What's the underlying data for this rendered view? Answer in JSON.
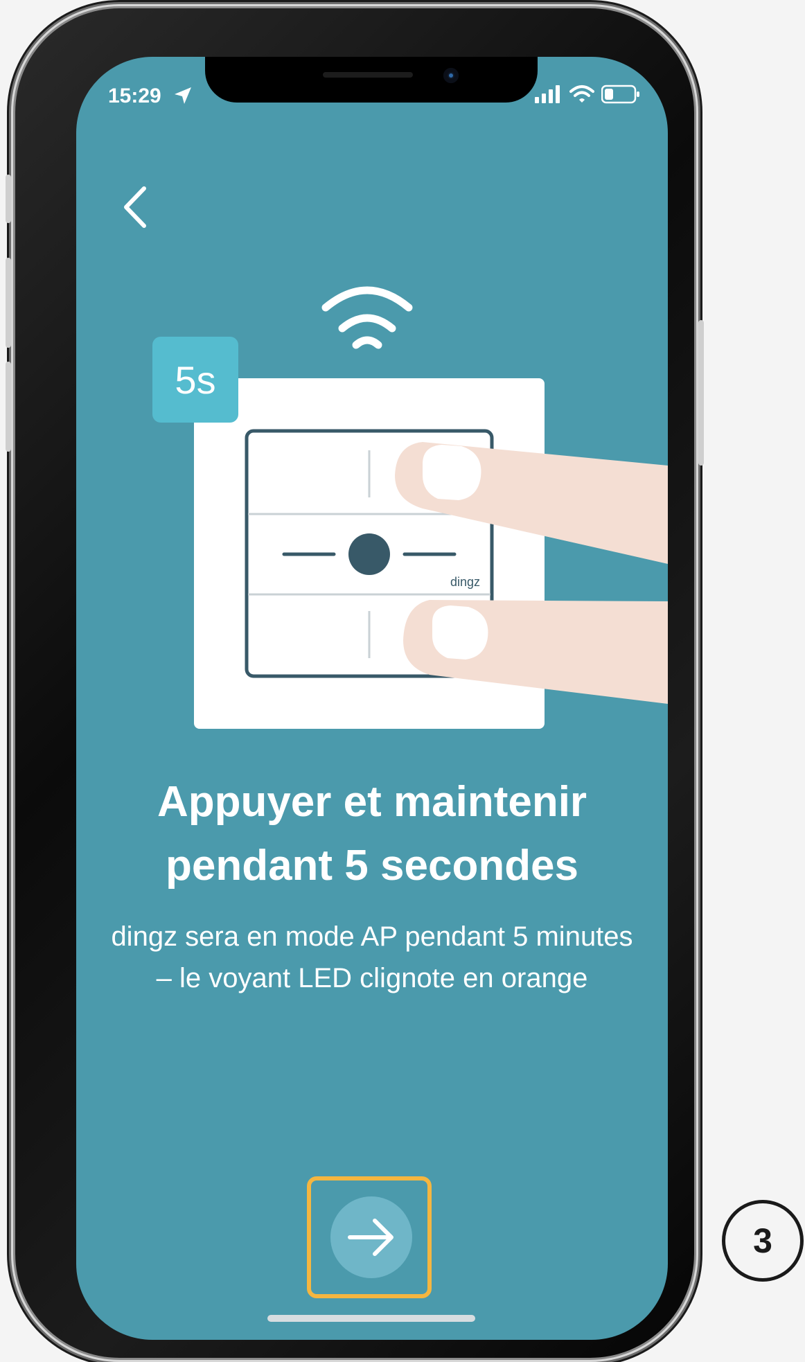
{
  "status_bar": {
    "time": "15:29"
  },
  "illustration": {
    "timer_badge": "5s",
    "brand": "dingz"
  },
  "content": {
    "title_line1": "Appuyer et maintenir",
    "title_line2": "pendant 5 secondes",
    "subtitle_line1": "dingz sera en mode AP pendant 5 minutes",
    "subtitle_line2": "– le voyant LED clignote en orange"
  },
  "step": {
    "number": "3"
  },
  "colors": {
    "screen_bg": "#4b9aac",
    "highlight": "#f5b640",
    "next_button": "#6fb6c8",
    "badge": "#55bccf"
  },
  "icons": [
    "back-chevron-icon",
    "wifi-signal-icon",
    "arrow-right-icon",
    "location-arrow-icon",
    "cellular-signal-icon",
    "wifi-status-icon",
    "battery-icon"
  ]
}
